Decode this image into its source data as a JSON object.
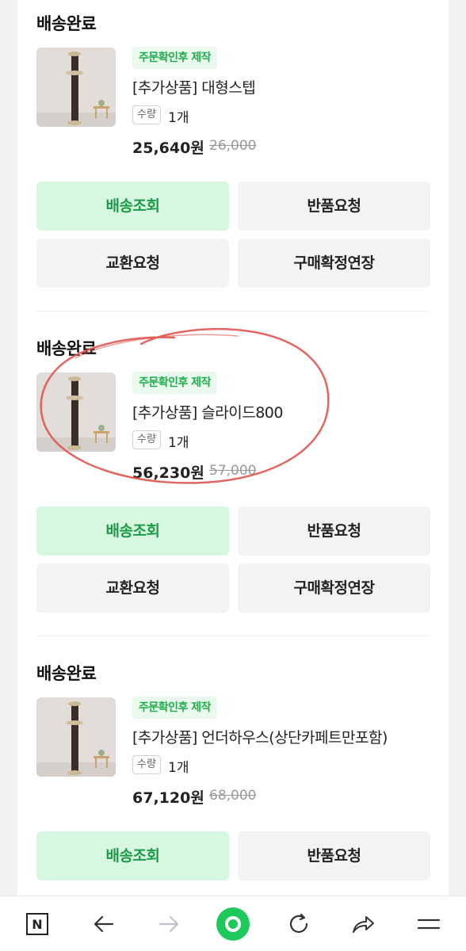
{
  "orders": [
    {
      "status": "배송완료",
      "badge": "주문확인후 제작",
      "product_name": "[추가상품] 대형스텝",
      "qty_label": "수량",
      "qty": "1개",
      "price": "25,640원",
      "original_price": "26,000",
      "buttons": [
        "배송조회",
        "반품요청",
        "교환요청",
        "구매확정연장"
      ]
    },
    {
      "status": "배송완료",
      "badge": "주문확인후 제작",
      "product_name": "[추가상품] 슬라이드800",
      "qty_label": "수량",
      "qty": "1개",
      "price": "56,230원",
      "original_price": "57,000",
      "buttons": [
        "배송조회",
        "반품요청",
        "교환요청",
        "구매확정연장"
      ]
    },
    {
      "status": "배송완료",
      "badge": "주문확인후 제작",
      "product_name": "[추가상품] 언더하우스(상단카페트만포함)",
      "qty_label": "수량",
      "qty": "1개",
      "price": "67,120원",
      "original_price": "68,000",
      "buttons": [
        "배송조회",
        "반품요청"
      ]
    }
  ],
  "colors": {
    "accent_green": "#1a9c46",
    "badge_bg": "#e9f9ee",
    "primary_button_bg": "#d7f7e1",
    "annotation_red": "#e0554f"
  },
  "bottom_nav": {
    "icons": [
      "naver-logo-icon",
      "back-arrow-icon",
      "forward-arrow-icon",
      "home-green-dot-icon",
      "refresh-icon",
      "share-icon",
      "menu-icon"
    ],
    "logo_letter": "N"
  }
}
